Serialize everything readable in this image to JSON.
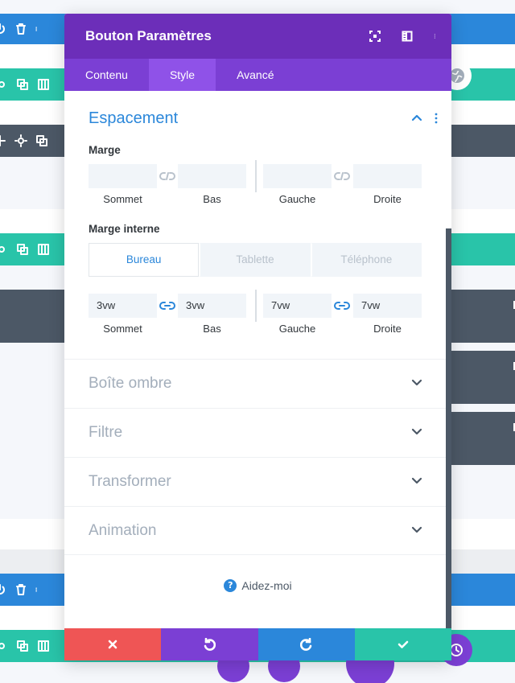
{
  "modal": {
    "title": "Bouton Paramètres",
    "tabs": [
      {
        "label": "Contenu"
      },
      {
        "label": "Style"
      },
      {
        "label": "Avancé"
      }
    ],
    "active_tab": "Style"
  },
  "spacing": {
    "title": "Espacement",
    "margin": {
      "label": "Marge",
      "fields": [
        {
          "label": "Sommet",
          "value": ""
        },
        {
          "label": "Bas",
          "value": ""
        },
        {
          "label": "Gauche",
          "value": ""
        },
        {
          "label": "Droite",
          "value": ""
        }
      ]
    },
    "padding": {
      "label": "Marge interne",
      "devices": [
        {
          "label": "Bureau"
        },
        {
          "label": "Tablette"
        },
        {
          "label": "Téléphone"
        }
      ],
      "active_device": "Bureau",
      "fields": [
        {
          "label": "Sommet",
          "value": "3vw"
        },
        {
          "label": "Bas",
          "value": "3vw"
        },
        {
          "label": "Gauche",
          "value": "7vw"
        },
        {
          "label": "Droite",
          "value": "7vw"
        }
      ]
    }
  },
  "sections": [
    {
      "label": "Boîte ombre"
    },
    {
      "label": "Filtre"
    },
    {
      "label": "Transformer"
    },
    {
      "label": "Animation"
    }
  ],
  "help": {
    "label": "Aidez-moi",
    "icon": "question-circle-icon"
  },
  "footer": {
    "cancel_color": "#ef5555",
    "undo_color": "#7b3fd4",
    "redo_color": "#2b87da",
    "save_color": "#29c4a9"
  },
  "colors": {
    "header": "#6c2eb9",
    "tabs": "#7b3fd4",
    "tab_active": "#8f52e8",
    "accent_blue": "#2b87da",
    "accent_green": "#29c4a9"
  }
}
